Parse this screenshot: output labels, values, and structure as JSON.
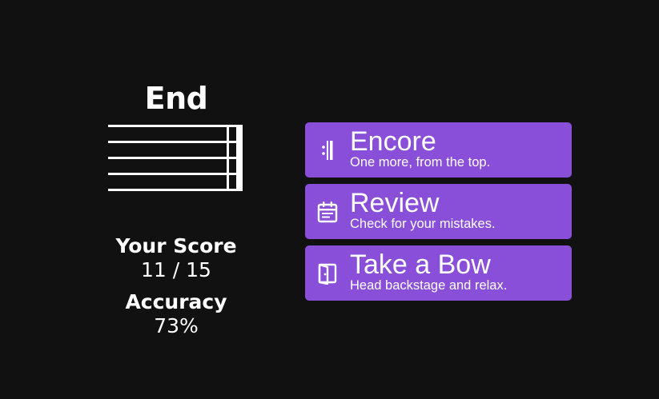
{
  "end_title": "End",
  "stats": {
    "score_label": "Your Score",
    "score_value": "11 / 15",
    "accuracy_label": "Accuracy",
    "accuracy_value": "73%"
  },
  "actions": [
    {
      "icon": "repeat-barline-icon",
      "title": "Encore",
      "subtitle": "One more, from the top."
    },
    {
      "icon": "calendar-icon",
      "title": "Review",
      "subtitle": "Check for your mistakes."
    },
    {
      "icon": "door-exit-icon",
      "title": "Take a Bow",
      "subtitle": "Head backstage and relax."
    }
  ],
  "colors": {
    "background": "#111111",
    "button": "#8a4fd8",
    "text": "#ffffff"
  }
}
